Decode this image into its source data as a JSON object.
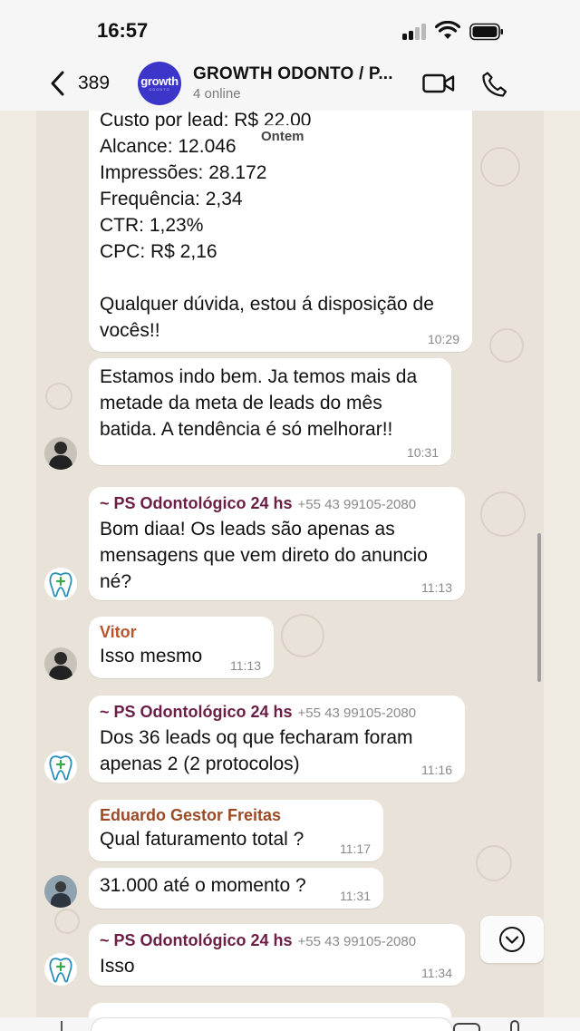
{
  "status": {
    "time": "16:57"
  },
  "header": {
    "back_count": "389",
    "avatar_text": "growth",
    "avatar_subtext": "ODONTO",
    "title": "GROWTH ODONTO / P...",
    "subtitle": "4 online"
  },
  "chat": {
    "date_label": "Ontem",
    "messages": [
      {
        "text": "Custo por lead: R$ 22,00\nAlcance: 12.046\nImpressões: 28.172\nFrequência: 2,34\nCTR: 1,23%\nCPC: R$ 2,16\n\nQualquer dúvida, estou á disposição de vocês!!",
        "time": "10:29"
      },
      {
        "text": "Estamos indo bem. Ja temos mais da metade da meta de leads do mês batida. A tendência é só melhorar!!",
        "time": "10:31"
      },
      {
        "sender": "~ PS Odontológico 24 hs",
        "phone": "+55 43 99105-2080",
        "text": "Bom diaa! Os leads são apenas as mensagens que vem direto do anuncio né?",
        "time": "11:13"
      },
      {
        "sender": "Vitor",
        "text": "Isso mesmo",
        "time": "11:13"
      },
      {
        "sender": "~ PS Odontológico 24 hs",
        "phone": "+55 43 99105-2080",
        "text": "Dos 36 leads oq que fecharam foram apenas 2 (2 protocolos)",
        "time": "11:16"
      },
      {
        "sender": "Eduardo Gestor Freitas",
        "text": "Qual faturamento total ?",
        "time": "11:17"
      },
      {
        "text": "31.000 até o momento ?",
        "time": "11:31"
      },
      {
        "sender": "~ PS Odontológico 24 hs",
        "phone": "+55 43 99105-2080",
        "text": "Isso",
        "time": "11:34"
      }
    ]
  }
}
